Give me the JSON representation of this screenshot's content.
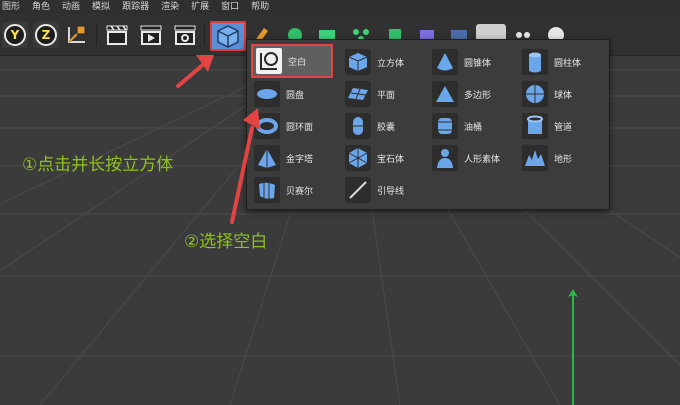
{
  "menubar": {
    "items": [
      "图形",
      "角色",
      "动画",
      "模拟",
      "跟踪器",
      "渲染",
      "扩展",
      "窗口",
      "帮助"
    ]
  },
  "toolbar": {
    "axis_y_label": "Y",
    "axis_z_label": "Z"
  },
  "dropdown": {
    "columns": [
      [
        {
          "label": "空白",
          "icon": "null-object-icon",
          "selected": true
        },
        {
          "label": "圆盘",
          "icon": "disc-icon"
        },
        {
          "label": "圆环面",
          "icon": "torus-icon"
        },
        {
          "label": "金字塔",
          "icon": "pyramid-icon"
        },
        {
          "label": "贝赛尔",
          "icon": "bezier-icon"
        }
      ],
      [
        {
          "label": "立方体",
          "icon": "cube-icon"
        },
        {
          "label": "平面",
          "icon": "plane-icon"
        },
        {
          "label": "胶囊",
          "icon": "capsule-icon"
        },
        {
          "label": "宝石体",
          "icon": "gem-icon"
        },
        {
          "label": "引导线",
          "icon": "guide-icon"
        }
      ],
      [
        {
          "label": "圆锥体",
          "icon": "cone-icon"
        },
        {
          "label": "多边形",
          "icon": "polygon-icon"
        },
        {
          "label": "油桶",
          "icon": "oil-tank-icon"
        },
        {
          "label": "人形素体",
          "icon": "figure-icon"
        }
      ],
      [
        {
          "label": "圆柱体",
          "icon": "cylinder-icon"
        },
        {
          "label": "球体",
          "icon": "sphere-icon"
        },
        {
          "label": "管道",
          "icon": "tube-icon"
        },
        {
          "label": "地形",
          "icon": "landscape-icon"
        }
      ]
    ]
  },
  "annotations": {
    "step1": "①点击并长按立方体",
    "step2": "②选择空白"
  },
  "colors": {
    "annotation_green": "#8ec21c",
    "highlight_red": "#e23b3b",
    "icon_blue": "#5a8fd6"
  }
}
